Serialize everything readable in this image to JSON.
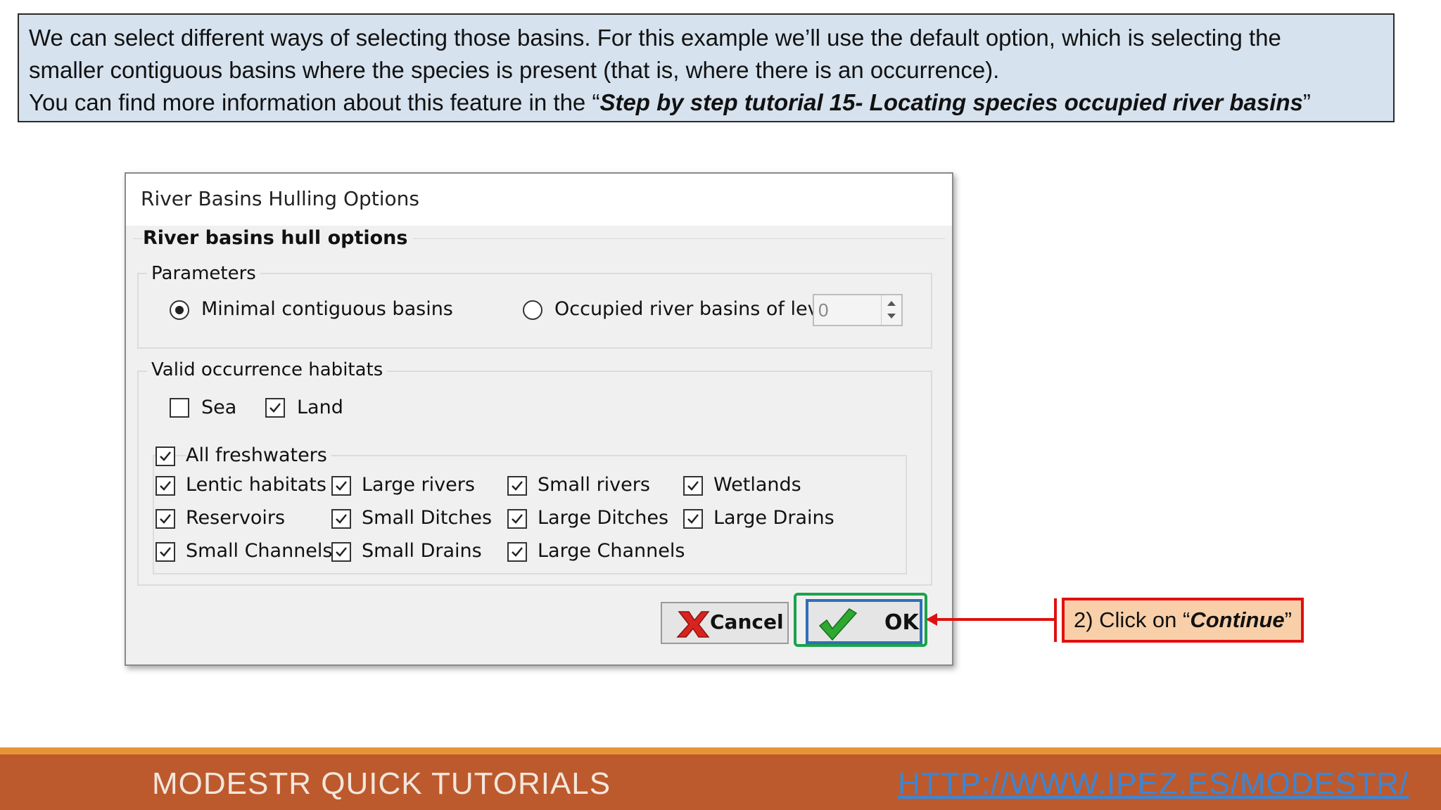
{
  "info": {
    "line1": "We can select different ways of selecting those basins. For this example we’ll use the default option, which is selecting the",
    "line2": "smaller contiguous basins where the species is present (that is, where there is an occurrence).",
    "line3_prefix": "You can find more information about this feature in the “",
    "line3_emph": "Step by step tutorial 15- Locating species occupied river basins",
    "line3_suffix": "”"
  },
  "dialog": {
    "title": "River Basins Hulling Options",
    "section_title": "River basins hull options",
    "parameters": {
      "legend": "Parameters",
      "option_minimal": "Minimal contiguous basins",
      "option_occupied": "Occupied river basins of level",
      "level_value": "0",
      "selected": "minimal"
    },
    "habitats": {
      "legend": "Valid occurrence habitats",
      "sea": {
        "label": "Sea",
        "checked": false
      },
      "land": {
        "label": "Land",
        "checked": true
      },
      "all_freshwaters": {
        "label": "All freshwaters",
        "checked": true
      },
      "items": [
        {
          "label": "Lentic habitats",
          "checked": true
        },
        {
          "label": "Large rivers",
          "checked": true
        },
        {
          "label": "Small rivers",
          "checked": true
        },
        {
          "label": "Wetlands",
          "checked": true
        },
        {
          "label": "Reservoirs",
          "checked": true
        },
        {
          "label": "Small Ditches",
          "checked": true
        },
        {
          "label": "Large Ditches",
          "checked": true
        },
        {
          "label": "Large Drains",
          "checked": true
        },
        {
          "label": "Small Channels",
          "checked": true
        },
        {
          "label": "Small Drains",
          "checked": true
        },
        {
          "label": "Large Channels",
          "checked": true
        }
      ]
    },
    "buttons": {
      "cancel": "Cancel",
      "ok": "OK"
    }
  },
  "callout": {
    "prefix": "2) Click on “",
    "emph": "Continue",
    "suffix": "”"
  },
  "footer": {
    "title": "MODESTR QUICK TUTORIALS",
    "link": "HTTP://WWW.IPEZ.ES/MODESTR/"
  },
  "colors": {
    "info_bg": "#d6e2ee",
    "footer_bg": "#bc5a2d",
    "footer_stripe": "#e69536",
    "callout_bg": "#f8cfa8",
    "annotation_red": "#e01010",
    "highlight_green": "#1aa34a"
  }
}
